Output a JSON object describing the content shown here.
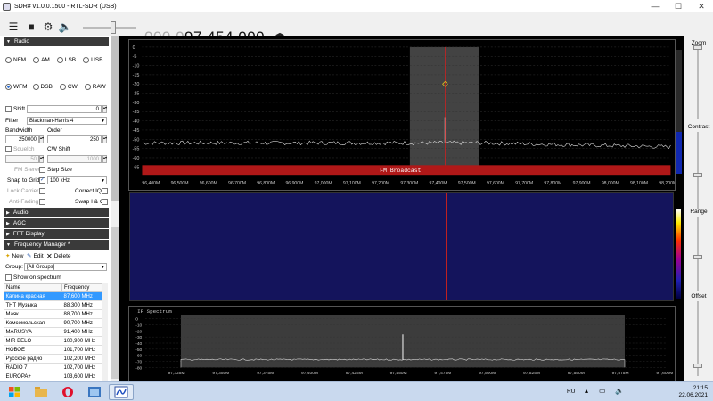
{
  "window": {
    "title": "SDR# v1.0.0.1500 - RTL-SDR (USB)",
    "controls": [
      "—",
      "☐",
      "✕"
    ]
  },
  "toolbar": {
    "frequency_dim": "000.0",
    "frequency_bright": "97.454.000",
    "freq_arrows": "◂▸"
  },
  "radio": {
    "section_title": "Radio",
    "modes_row1": [
      "NFM",
      "AM",
      "LSB",
      "USB"
    ],
    "modes_row2": [
      "WFM",
      "DSB",
      "CW",
      "RAW"
    ],
    "selected_mode": "WFM",
    "shift_label": "Shift",
    "shift_value": "0",
    "filter_label": "Filter",
    "filter_value": "Blackman-Harris 4",
    "bandwidth_label": "Bandwidth",
    "bandwidth_value": "250000",
    "order_label": "Order",
    "order_value": "250",
    "squelch_label": "Squelch",
    "squelch_value": "50",
    "cw_shift_label": "CW Shift",
    "cw_shift_value": "1000",
    "fm_stereo_label": "FM Stereo",
    "step_size_label": "Step Size",
    "snap_to_grid_label": "Snap to Grid",
    "step_value": "100 kHz",
    "lock_carrier_label": "Lock Carrier",
    "correct_iq_label": "Correct IQ",
    "anti_fading_label": "Anti-Fading",
    "swap_iq_label": "Swap I & Q"
  },
  "sections": {
    "audio": "Audio",
    "agc": "AGC",
    "fft_display": "FFT Display",
    "frequency_manager": "Frequency Manager *"
  },
  "freq_manager": {
    "new_label": "New",
    "edit_label": "Edit",
    "delete_label": "Delete",
    "group_label": "Group:",
    "group_value": "[All Groups]",
    "show_on_spectrum": "Show on spectrum",
    "columns": [
      "Name",
      "Frequency"
    ],
    "rows": [
      {
        "name": "Калина красная",
        "freq": "87,600 MHz",
        "selected": true
      },
      {
        "name": "ТНТ Музыка",
        "freq": "88,300 MHz"
      },
      {
        "name": "Маяк",
        "freq": "88,700 MHz"
      },
      {
        "name": "Комсомольская",
        "freq": "90,700 MHz"
      },
      {
        "name": "MARUSYA",
        "freq": "91,400 MHz"
      },
      {
        "name": "MIR BELO",
        "freq": "100,900 MHz"
      },
      {
        "name": "НОВОЕ",
        "freq": "101,700 MHz"
      },
      {
        "name": "Русское радио",
        "freq": "102,200 MHz"
      },
      {
        "name": "RADIO 7",
        "freq": "102,700 MHz"
      },
      {
        "name": "EUROPA+",
        "freq": "103,600 MHz"
      }
    ]
  },
  "spectrum_main": {
    "y_ticks": [
      "0",
      "-5",
      "-10",
      "-15",
      "-20",
      "-25",
      "-30",
      "-35",
      "-40",
      "-45",
      "-50",
      "-55",
      "-60",
      "-65"
    ],
    "x_ticks": [
      "96,400M",
      "96,500M",
      "96,600M",
      "96,700M",
      "96,800M",
      "96,900M",
      "97,000M",
      "97,100M",
      "97,200M",
      "97,300M",
      "97,400M",
      "97,500M",
      "97,600M",
      "97,700M",
      "97,800M",
      "97,900M",
      "98,000M",
      "98,100M",
      "98,200M"
    ],
    "band_label": "FM Broadcast",
    "peak_db": -38,
    "noise_floor_db": -52
  },
  "spectrum_if": {
    "title": "IF Spectrum",
    "y_ticks": [
      "0",
      "-10",
      "-20",
      "-30",
      "-40",
      "-50",
      "-60",
      "-70",
      "-80"
    ],
    "x_ticks": [
      "97,325M",
      "97,350M",
      "97,375M",
      "97,400M",
      "97,425M",
      "97,450M",
      "97,475M",
      "97,500M",
      "97,525M",
      "97,550M",
      "97,575M",
      "97,600M"
    ]
  },
  "right_panel": {
    "zoom_label": "Zoom",
    "contrast_label": "Contrast",
    "contrast_value": "37",
    "range_label": "Range",
    "offset_label": "Offset"
  },
  "taskbar": {
    "lang": "RU",
    "time": "21:15",
    "date": "22.06.2021"
  },
  "colors": {
    "accent": "#3399ff",
    "band_red": "#b01818",
    "waterfall_bg": "#14145c",
    "filter_region": "#5a5a5a",
    "center_line": "#cc2222"
  }
}
